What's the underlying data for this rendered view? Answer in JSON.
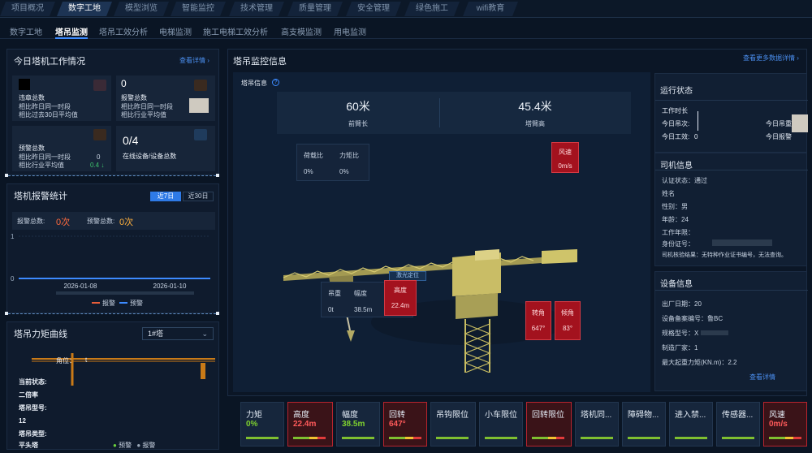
{
  "topnav": {
    "tabs": [
      {
        "label": "项目概况"
      },
      {
        "label": "数字工地"
      },
      {
        "label": "模型浏览"
      },
      {
        "label": "智能监控"
      },
      {
        "label": "技术管理"
      },
      {
        "label": "质量管理"
      },
      {
        "label": "安全管理"
      },
      {
        "label": "绿色施工"
      },
      {
        "label": "wifi教育"
      }
    ]
  },
  "subnav": {
    "tabs": [
      {
        "label": "数字工地"
      },
      {
        "label": "塔吊监测"
      },
      {
        "label": "塔吊工效分析"
      },
      {
        "label": "电梯监测"
      },
      {
        "label": "施工电梯工效分析"
      },
      {
        "label": "高支模监测"
      },
      {
        "label": "用电监测"
      }
    ]
  },
  "work": {
    "title": "今日塔机工作情况",
    "link": "查看详情 ›",
    "c1": {
      "label": "违章总数",
      "l1": "相比昨日同一时段",
      "l2": "相比过去30日平均值"
    },
    "c2": {
      "value": "0",
      "label": "报警总数",
      "l1": "相比昨日同一时段",
      "l2": "相比行业平均值"
    },
    "c3": {
      "label": "预警总数",
      "l1": "相比昨日同一时段",
      "l2": "相比行业平均值",
      "v1": "0",
      "v2": "0.4 ↓"
    },
    "c4": {
      "value": "0/4",
      "label": "在线设备/设备总数"
    }
  },
  "alarm": {
    "title": "塔机报警统计",
    "btn7": "近7日",
    "btn30": "近30日",
    "alarm_label": "报警总数:",
    "alarm_val": "0次",
    "warn_label": "预警总数:",
    "warn_val": "0次",
    "legend_alarm": "报警",
    "legend_warn": "预警"
  },
  "chart_data": {
    "type": "line",
    "categories": [
      "2026-01-08",
      "2026-01-10"
    ],
    "yticks": [
      "1",
      "0"
    ],
    "ylim": [
      0,
      1
    ],
    "series": [
      {
        "name": "报警",
        "values": [
          0,
          0
        ]
      },
      {
        "name": "预警",
        "values": [
          0,
          0
        ]
      }
    ]
  },
  "torque": {
    "title": "塔吊力矩曲线",
    "select": "1#塔",
    "pos_label": "角位：",
    "info": [
      {
        "label": "当前状态:"
      },
      {
        "label": "二倍率"
      },
      {
        "label": "塔吊型号:"
      },
      {
        "label": "12"
      },
      {
        "label": "塔吊类型:"
      },
      {
        "label": "平头塔"
      }
    ],
    "legend_warn": "预警",
    "legend_alarm": "报警"
  },
  "monitor": {
    "title": "塔吊监控信息",
    "link": "查看更多数据详情 ›",
    "info_label": "塔吊信息",
    "arm_val": "60米",
    "arm_label": "前臂长",
    "height_val": "45.4米",
    "height_label": "塔臂高",
    "load_ratio": {
      "label": "荷载比",
      "value": "0%"
    },
    "torque_ratio": {
      "label": "力矩比",
      "value": "0%"
    },
    "wind": {
      "label": "风速",
      "value": "0m/s"
    },
    "laser": "激光定位",
    "hook": {
      "weight_label": "吊重",
      "weight_val": "0t",
      "range_label": "幅度",
      "range_val": "38.5m",
      "height_label": "高度",
      "height_val": "22.4m"
    },
    "rotate": {
      "label": "转角",
      "value": "647°"
    },
    "tilt": {
      "label": "倾角",
      "value": "83°"
    }
  },
  "status": {
    "title": "运行状态",
    "work_time": "工作时长",
    "today_lift": "今日吊次:",
    "today_work": "今日工效:",
    "today_work_val": "0",
    "r1": "今日吊重",
    "r2": "今日报警"
  },
  "driver": {
    "title": "司机信息",
    "lines": [
      {
        "text": "认证状态：通过"
      },
      {
        "text": "姓名"
      },
      {
        "text": "性别：男"
      },
      {
        "text": "年龄：24"
      },
      {
        "text": "工作年限："
      },
      {
        "text": "身份证号："
      },
      {
        "text": "司机核验结果：无特种作业证书编号，无法查询。"
      }
    ]
  },
  "equip": {
    "title": "设备信息",
    "lines": [
      {
        "text": "出厂日期：20"
      },
      {
        "text": "设备备案编号：鲁BC"
      },
      {
        "text": "规格型号：X"
      },
      {
        "text": "制造厂家：1"
      },
      {
        "text": "最大起重力矩(KN.m)：2.2"
      }
    ],
    "link": "查看详情"
  },
  "sensors": [
    {
      "name": "力矩",
      "value": "0%",
      "color": "#7fd12f",
      "red": false
    },
    {
      "name": "高度",
      "value": "22.4m",
      "color": "#ff5a5a",
      "red": true
    },
    {
      "name": "幅度",
      "value": "38.5m",
      "color": "#7fd12f",
      "red": false
    },
    {
      "name": "回转",
      "value": "647°",
      "color": "#ff5a5a",
      "red": true
    },
    {
      "name": "吊钩限位",
      "value": "",
      "color": "#7fd12f",
      "red": false
    },
    {
      "name": "小车限位",
      "value": "",
      "color": "#7fd12f",
      "red": false
    },
    {
      "name": "回转限位",
      "value": "",
      "color": "#7fd12f",
      "red": true
    },
    {
      "name": "塔机同...",
      "value": "",
      "color": "#7fd12f",
      "red": false
    },
    {
      "name": "障碍物...",
      "value": "",
      "color": "#7fd12f",
      "red": false
    },
    {
      "name": "进入禁...",
      "value": "",
      "color": "#7fd12f",
      "red": false
    },
    {
      "name": "传感器...",
      "value": "",
      "color": "#7fd12f",
      "red": false
    },
    {
      "name": "风速",
      "value": "0m/s",
      "color": "#ff5a5a",
      "red": true
    }
  ]
}
